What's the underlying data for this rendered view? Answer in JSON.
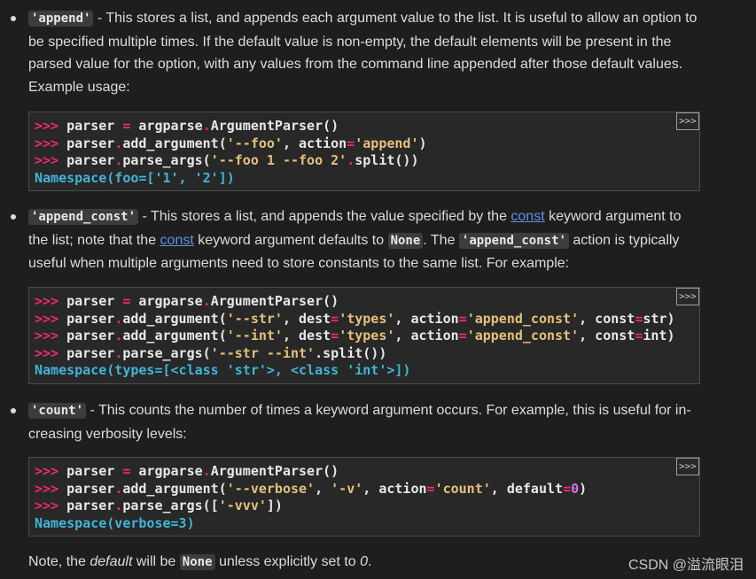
{
  "items": [
    {
      "code_label": "'append'",
      "text": " - This stores a list, and appends each argument value to the list. It is useful to allow an option to be specified multiple times. If the default value is non-empty, the default elements will be present in the parsed value for the option, with any values from the command line appended after those default values. Example usage:",
      "line1": " - This stores a list, and appends each argument value to the list. It is useful to allow an option to",
      "line2": "be specified multiple times. If the default value is non-empty, the default elements will be present in the",
      "line3": "parsed value for the option, with any values from the command line appended after those default values.",
      "line4": "Example usage:"
    },
    {
      "code_label": "'append_const'",
      "t1": " - This stores a list, and appends the value specified by the ",
      "link1": "const",
      "t2": " keyword argument to",
      "t3": "the list; note that the ",
      "link2": "const",
      "t4": " keyword argument defaults to ",
      "code2": "None",
      "t5": ". The ",
      "code3": "'append_const'",
      "t6": " action is typically",
      "t7": "useful when multiple arguments need to store constants to the same list. For example:"
    },
    {
      "code_label": "'count'",
      "t1": " - This counts the number of times a keyword argument occurs. For example, this is useful for in-",
      "t2": "creasing verbosity levels:"
    }
  ],
  "copy_button_label": ">>>",
  "prompt": ">>>",
  "code_blocks": {
    "b1": {
      "l1a": " parser ",
      "l1b": "=",
      "l1c": " argparse",
      "l1d": ".",
      "l1e": "ArgumentParser()",
      "l2a": " parser",
      "l2b": ".",
      "l2c": "add_argument(",
      "l2d": "'--foo'",
      "l2e": ", action",
      "l2f": "=",
      "l2g": "'append'",
      "l2h": ")",
      "l3a": " parser",
      "l3b": ".",
      "l3c": "parse_args(",
      "l3d": "'--foo 1 --foo 2'",
      "l3e": ".",
      "l3f": "split())",
      "out": "Namespace(foo=['1', '2'])"
    },
    "b2": {
      "l1a": " parser ",
      "l1b": "=",
      "l1c": " argparse",
      "l1d": ".",
      "l1e": "ArgumentParser()",
      "l2a": " parser",
      "l2b": ".",
      "l2c": "add_argument(",
      "l2d": "'--str'",
      "l2e": ", dest",
      "l2f": "=",
      "l2g": "'types'",
      "l2h": ", action",
      "l2i": "=",
      "l2j": "'append_const'",
      "l2k": ", const",
      "l2l": "=",
      "l2m": "str)",
      "l3a": " parser",
      "l3b": ".",
      "l3c": "add_argument(",
      "l3d": "'--int'",
      "l3e": ", dest",
      "l3f": "=",
      "l3g": "'types'",
      "l3h": ", action",
      "l3i": "=",
      "l3j": "'append_const'",
      "l3k": ", const",
      "l3l": "=",
      "l3m": "int)",
      "l4a": " parser",
      "l4b": ".",
      "l4c": "parse_args(",
      "l4d": "'--str --int'",
      "l4e": ".",
      "l4f": "split())",
      "out": "Namespace(types=[<class 'str'>, <class 'int'>])"
    },
    "b3": {
      "l1a": " parser ",
      "l1b": "=",
      "l1c": " argparse",
      "l1d": ".",
      "l1e": "ArgumentParser()",
      "l2a": " parser",
      "l2b": ".",
      "l2c": "add_argument(",
      "l2d": "'--verbose'",
      "l2e": ", ",
      "l2f": "'-v'",
      "l2g": ", action",
      "l2h": "=",
      "l2i": "'count'",
      "l2j": ", default",
      "l2k": "=",
      "l2l": "0",
      "l2m": ")",
      "l3a": " parser",
      "l3b": ".",
      "l3c": "parse_args([",
      "l3d": "'-vvv'",
      "l3e": "])",
      "out": "Namespace(verbose=3)"
    }
  },
  "note": {
    "t1": "Note, the ",
    "em1": "default",
    "t2": " will be ",
    "code": "None",
    "t3": " unless explicitly set to ",
    "em2": "0",
    "t4": "."
  },
  "watermark": "CSDN @溢流眼泪"
}
